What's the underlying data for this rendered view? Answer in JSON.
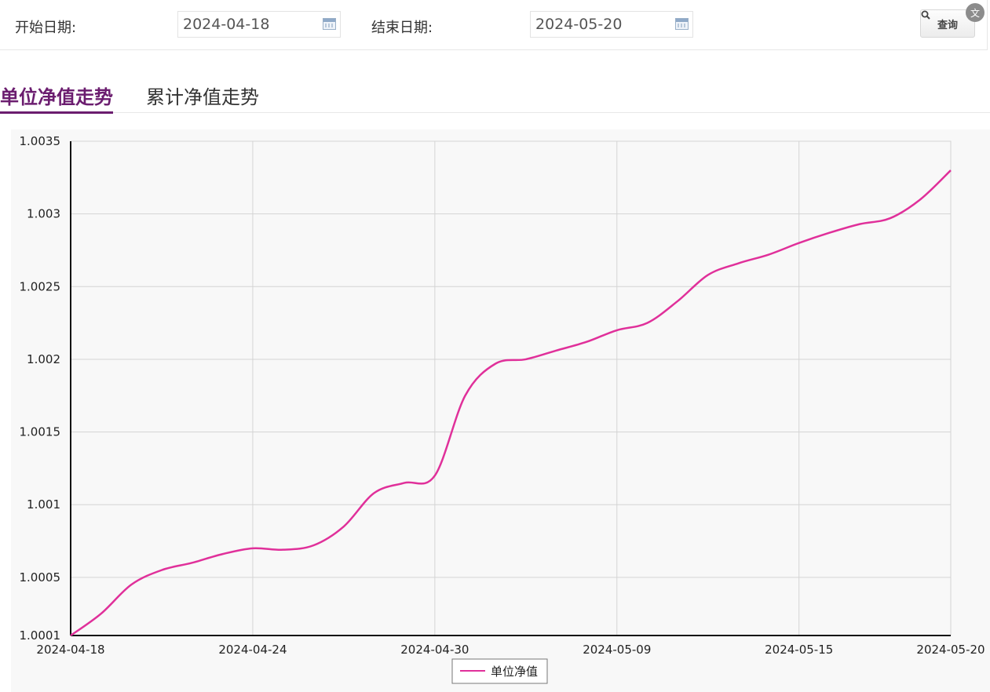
{
  "filter": {
    "start_label": "开始日期:",
    "start_value": "2024-04-18",
    "end_label": "结束日期:",
    "end_value": "2024-05-20",
    "query_label": "查询",
    "translate_glyph": "文"
  },
  "tabs": [
    {
      "label": "单位净值走势",
      "active": true
    },
    {
      "label": "累计净值走势",
      "active": false
    }
  ],
  "colors": {
    "accent": "#6b1d6f",
    "series": "#e0309a"
  },
  "chart_data": {
    "type": "line",
    "xlabel": "",
    "ylabel": "",
    "x_tick_labels": [
      "2024-04-18",
      "2024-04-24",
      "2024-04-30",
      "2024-05-09",
      "2024-05-15",
      "2024-05-20"
    ],
    "y_tick_labels": [
      "1.0001",
      "1.0005",
      "1.001",
      "1.0015",
      "1.002",
      "1.0025",
      "1.003",
      "1.0035"
    ],
    "ylim": [
      1.0001,
      1.0035
    ],
    "grid": true,
    "legend_position": "bottom-center",
    "categories": [
      "2024-04-18",
      "2024-04-19",
      "2024-04-20",
      "2024-04-21",
      "2024-04-22",
      "2024-04-23",
      "2024-04-24",
      "2024-04-25",
      "2024-04-26",
      "2024-04-27",
      "2024-04-28",
      "2024-04-29",
      "2024-04-30",
      "2024-05-01",
      "2024-05-05",
      "2024-05-06",
      "2024-05-07",
      "2024-05-08",
      "2024-05-09",
      "2024-05-10",
      "2024-05-11",
      "2024-05-12",
      "2024-05-13",
      "2024-05-14",
      "2024-05-15",
      "2024-05-16",
      "2024-05-17",
      "2024-05-18",
      "2024-05-19",
      "2024-05-20"
    ],
    "series": [
      {
        "name": "单位净值",
        "values": [
          1.0001,
          1.00025,
          1.00045,
          1.00055,
          1.0006,
          1.00066,
          1.0007,
          1.00069,
          1.00072,
          1.00085,
          1.00108,
          1.00115,
          1.0012,
          1.00175,
          1.00197,
          1.002,
          1.00206,
          1.00212,
          1.0022,
          1.00225,
          1.0024,
          1.00258,
          1.00266,
          1.00272,
          1.0028,
          1.00287,
          1.00293,
          1.00297,
          1.0031,
          1.0033
        ]
      }
    ]
  }
}
